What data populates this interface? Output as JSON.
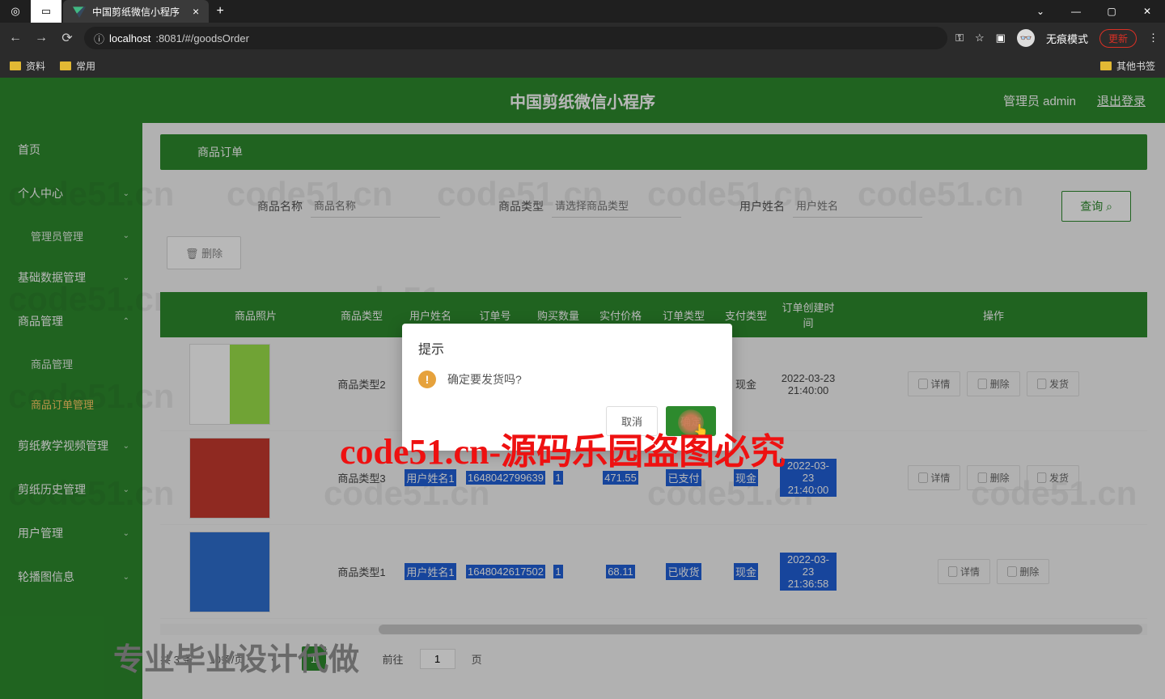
{
  "browser": {
    "tab_title": "中国剪纸微信小程序",
    "url_host": "localhost",
    "url_path": ":8081/#/goodsOrder",
    "incognito": "无痕模式",
    "update": "更新",
    "bookmarks": [
      "资料",
      "常用"
    ],
    "other_bookmarks": "其他书签"
  },
  "header": {
    "title": "中国剪纸微信小程序",
    "admin": "管理员 admin",
    "logout": "退出登录"
  },
  "sidebar": {
    "items": [
      {
        "label": "首页",
        "chev": false
      },
      {
        "label": "个人中心",
        "chev": true
      },
      {
        "label": "管理员管理",
        "chev": true,
        "sub": true
      },
      {
        "label": "基础数据管理",
        "chev": true
      },
      {
        "label": "商品管理",
        "chev": true
      },
      {
        "label": "商品管理",
        "sub": true
      },
      {
        "label": "商品订单管理",
        "sub": true,
        "active": true
      },
      {
        "label": "剪纸教学视频管理",
        "chev": true
      },
      {
        "label": "剪纸历史管理",
        "chev": true
      },
      {
        "label": "用户管理",
        "chev": true
      },
      {
        "label": "轮播图信息",
        "chev": true
      }
    ]
  },
  "breadcrumb": "商品订单",
  "search": {
    "name_label": "商品名称",
    "name_ph": "商品名称",
    "type_label": "商品类型",
    "type_ph": "请选择商品类型",
    "user_label": "用户姓名",
    "user_ph": "用户姓名",
    "query": "查询"
  },
  "toolbar": {
    "delete": "删除"
  },
  "table": {
    "headers": {
      "img": "商品照片",
      "type": "商品类型",
      "user": "用户姓名",
      "order": "订单号",
      "qty": "购买数量",
      "price": "实付价格",
      "ot": "订单类型",
      "pay": "支付类型",
      "time": "订单创建时间",
      "ops": "操作"
    },
    "rows": [
      {
        "type": "商品类型2",
        "user": "",
        "order": "",
        "qty": "",
        "price": "",
        "ot": "",
        "pay": "现金",
        "time": "2022-03-23 21:40:00",
        "ops": [
          "详情",
          "删除",
          "发货"
        ],
        "img": "p1"
      },
      {
        "type": "商品类型3",
        "user": "用户姓名1",
        "order": "1648042799639",
        "qty": "1",
        "price": "471.55",
        "ot": "已支付",
        "pay": "现金",
        "time": "2022-03-23 21:40:00",
        "ops": [
          "详情",
          "删除",
          "发货"
        ],
        "img": "p2",
        "sel": true
      },
      {
        "type": "商品类型1",
        "user": "用户姓名1",
        "order": "1648042617502",
        "qty": "1",
        "price": "68.11",
        "ot": "已收货",
        "pay": "现金",
        "time": "2022-03-23 21:36:58",
        "ops": [
          "详情",
          "删除"
        ],
        "img": "p3",
        "sel": true
      }
    ]
  },
  "pager": {
    "total": "共 3 条",
    "size": "10条/页",
    "cur": "1",
    "goto": "前往",
    "page": "页",
    "input": "1"
  },
  "modal": {
    "title": "提示",
    "msg": "确定要发货吗?",
    "cancel": "取消",
    "ok": "确定"
  },
  "overlay": {
    "red": "code51.cn-源码乐园盗图必究",
    "gray": "专业毕业设计代做"
  },
  "watermark": "code51.cn"
}
